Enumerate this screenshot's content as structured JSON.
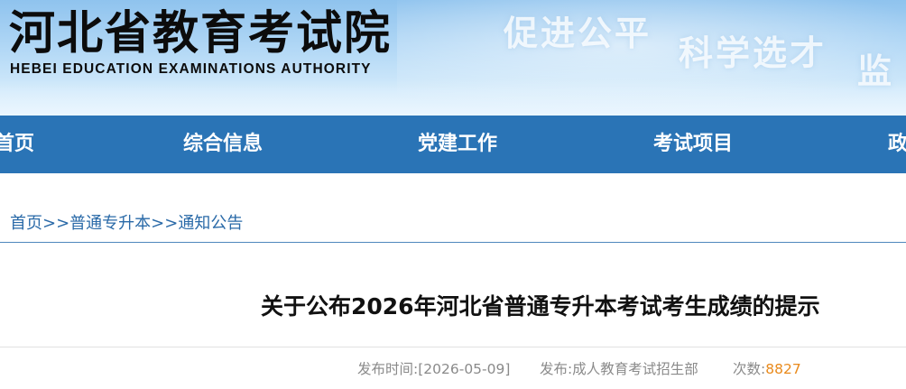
{
  "banner": {
    "title_cn": "河北省教育考试院",
    "title_en": "HEBEI EDUCATION EXAMINATIONS AUTHORITY",
    "slogans": [
      "促进公平",
      "科学选才",
      "监"
    ]
  },
  "nav": {
    "items": [
      {
        "label": "首页"
      },
      {
        "label": "综合信息"
      },
      {
        "label": "党建工作"
      },
      {
        "label": "考试项目"
      },
      {
        "label": "政"
      }
    ]
  },
  "breadcrumb": {
    "items": [
      "首页",
      "普通专升本",
      "通知公告"
    ],
    "separator": ">>"
  },
  "article": {
    "title": "关于公布2026年河北省普通专升本考试考生成绩的提示",
    "meta": {
      "publish_time_label": "发布时间:",
      "publish_time": "[2026-05-09]",
      "publisher_label": "发布:",
      "publisher": "成人教育考试招生部",
      "views_label": "次数:",
      "views": "8827"
    }
  },
  "colors": {
    "nav_bg": "#2a74b6",
    "link": "#2a6aa8",
    "view_count": "#e98a1c"
  }
}
